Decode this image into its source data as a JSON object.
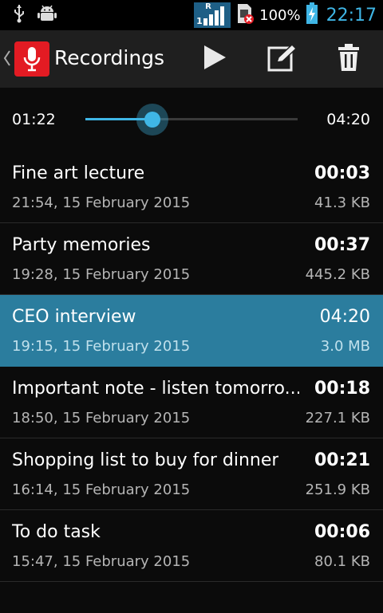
{
  "status_bar": {
    "battery_percent": "100%",
    "time": "22:17",
    "signal_indicator": "R",
    "sim_slot": "1",
    "icons": [
      "usb-icon",
      "android-debug-icon",
      "signal-bars-icon",
      "sim-error-icon",
      "battery-charging-icon"
    ]
  },
  "action_bar": {
    "title": "Recordings",
    "actions": [
      "play-icon",
      "edit-icon",
      "delete-icon"
    ]
  },
  "player": {
    "current_time": "01:22",
    "total_time": "04:20",
    "progress": 0.315
  },
  "recordings": [
    {
      "title": "Fine art lecture",
      "duration": "00:03",
      "date": "21:54, 15 February 2015",
      "size": "41.3 KB",
      "selected": false
    },
    {
      "title": "Party memories",
      "duration": "00:37",
      "date": "19:28, 15 February 2015",
      "size": "445.2 KB",
      "selected": false
    },
    {
      "title": "CEO interview",
      "duration": "04:20",
      "date": "19:15, 15 February 2015",
      "size": "3.0 MB",
      "selected": true
    },
    {
      "title": "Important note - listen tomorro...",
      "duration": "00:18",
      "date": "18:50, 15 February 2015",
      "size": "227.1 KB",
      "selected": false
    },
    {
      "title": "Shopping list to buy for dinner",
      "duration": "00:21",
      "date": "16:14, 15 February 2015",
      "size": "251.9 KB",
      "selected": false
    },
    {
      "title": "To do task",
      "duration": "00:06",
      "date": "15:47, 15 February 2015",
      "size": "80.1 KB",
      "selected": false
    }
  ],
  "colors": {
    "accent": "#3fb6e6",
    "selected_row": "#2b7d9e",
    "app_icon": "#e31b23"
  }
}
